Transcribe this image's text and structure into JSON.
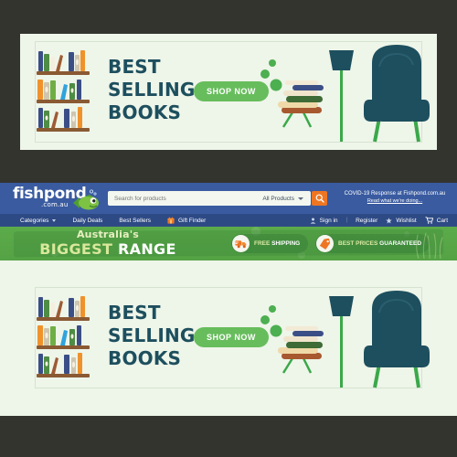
{
  "page": {
    "background_color": "#34342f",
    "site_background": "#eef5e9"
  },
  "banner": {
    "headline_line1": "BEST",
    "headline_line2": "SELLING",
    "headline_line3": "BOOKS",
    "cta_label": "SHOP NOW",
    "headline_color": "#1d4f5e",
    "cta_color": "#67bd5c",
    "background_color": "#eef5e9",
    "artwork": {
      "left": "bookshelf-three-shelves",
      "right": "reading-corner-armchair-lamp-side-table-books",
      "bubbles": 3
    }
  },
  "header": {
    "logo_name": "fishpond",
    "logo_dot": ".",
    "logo_domain": ".com.au",
    "mascot": "fish-mascot",
    "background_color": "#3a5ba0",
    "search": {
      "placeholder": "Search for products",
      "value": "",
      "category_selected": "All Products",
      "category_options": [
        "All Products"
      ],
      "button_icon": "search-icon",
      "button_color": "#ee7623"
    },
    "covid": {
      "line1": "COVID-19 Response at Fishpond.com.au",
      "line2": "Read what we're doing..."
    }
  },
  "nav": {
    "background_color": "#2e4a85",
    "items": [
      {
        "label": "Categories",
        "icon": "chevron-down-icon"
      },
      {
        "label": "Daily Deals",
        "icon": ""
      },
      {
        "label": "Best Sellers",
        "icon": ""
      },
      {
        "label": "Gift Finder",
        "icon": "gift-icon"
      }
    ],
    "account": [
      {
        "label": "Sign in",
        "icon": "user-icon"
      },
      {
        "label": "Register",
        "icon": ""
      },
      {
        "label": "Wishlist",
        "icon": "star-icon"
      },
      {
        "label": "Cart",
        "icon": "cart-icon"
      }
    ],
    "separator": "|"
  },
  "promo": {
    "line1": "Australia's",
    "line2_part1": "BIGGEST",
    "line2_part2": "RANGE",
    "background_color": "#54a244",
    "badges": [
      {
        "label_light": "FREE",
        "label_bold": "SHIPPING",
        "icon": "truck-icon"
      },
      {
        "label_light": "BEST PRICES",
        "label_bold": "GUARANTEED",
        "icon": "price-tag-icon"
      }
    ]
  }
}
